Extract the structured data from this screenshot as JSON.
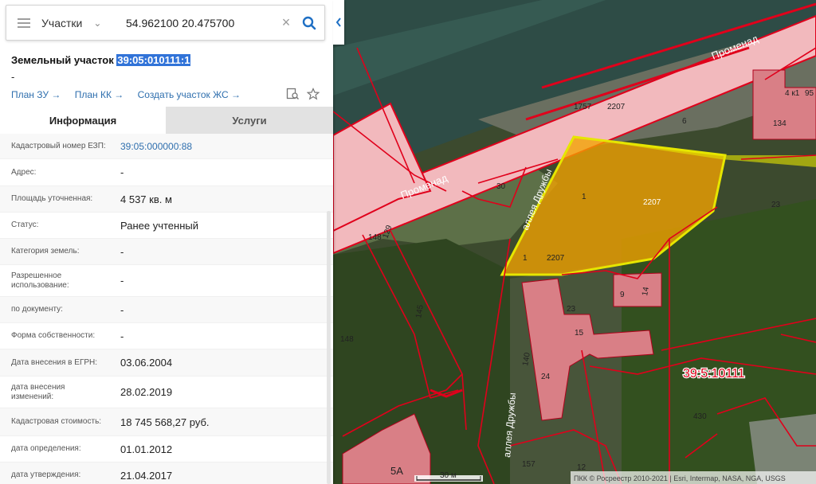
{
  "search": {
    "type_label": "Участки",
    "query": "54.962100 20.475700"
  },
  "parcel": {
    "title_prefix": "Земельный участок ",
    "cadastral_number": "39:05:010111:1",
    "subtitle": "-"
  },
  "links": {
    "plan_zu": "План ЗУ →",
    "plan_kk": "План КК →",
    "create_zhs": "Создать участок ЖС →"
  },
  "tabs": {
    "info": "Информация",
    "services": "Услуги"
  },
  "rows": [
    {
      "label": "Кадастровый номер ЕЗП:",
      "value": "39:05:000000:88",
      "link": true
    },
    {
      "label": "Адрес:",
      "value": "-"
    },
    {
      "label": "Площадь уточненная:",
      "value": "4 537 кв. м"
    },
    {
      "label": "Статус:",
      "value": "Ранее учтенный"
    },
    {
      "label": "Категория земель:",
      "value": "-"
    },
    {
      "label": "Разрешенное использование:",
      "value": "-"
    },
    {
      "label": "по документу:",
      "value": "-"
    },
    {
      "label": "Форма собственности:",
      "value": "-"
    },
    {
      "label": "Дата внесения в ЕГРН:",
      "value": "03.06.2004"
    },
    {
      "label": "дата внесения изменений:",
      "value": "28.02.2019"
    },
    {
      "label": "Кадастровая стоимость:",
      "value": "18 745 568,27 руб."
    },
    {
      "label": "дата определения:",
      "value": "01.01.2012"
    },
    {
      "label": "дата утверждения:",
      "value": "21.04.2017"
    }
  ],
  "map": {
    "labels": {
      "promenad_top": "Променад",
      "promenad_left": "Променад",
      "alley_top": "аллея Дружбы",
      "alley_bottom": "аллея Дружбы",
      "n1757": "1757",
      "n2207a": "2207",
      "n2207b": "2207",
      "n2207c": "2207",
      "n6": "6",
      "n4k1": "4 к1",
      "n95": "95",
      "n134": "134",
      "n30": "30",
      "n23a": "23",
      "n148a": "148",
      "n129": "129",
      "n1a": "1",
      "n1b": "1",
      "n9": "9",
      "n14": "14",
      "n23b": "23",
      "n15": "15",
      "n145": "145",
      "n148b": "148",
      "n24": "24",
      "n140": "140",
      "cadastre_block": "39:5:10111",
      "n430": "430",
      "n5a": "5А",
      "n157": "157",
      "n12": "12"
    },
    "scale_label": "30 м",
    "attribution": "ПКК © Росреестр 2010-2021 | Esri, Intermap, NASA, NGA, USGS",
    "colors": {
      "boundary": "#e0001b",
      "road_fill": "#f4b8bc",
      "building_fill": "#d97f86",
      "selected_parcel": "#f4a300",
      "selected_outline": "#e6e600",
      "link_color": "#2f6fae",
      "highlight_bg": "#3173d8"
    }
  }
}
